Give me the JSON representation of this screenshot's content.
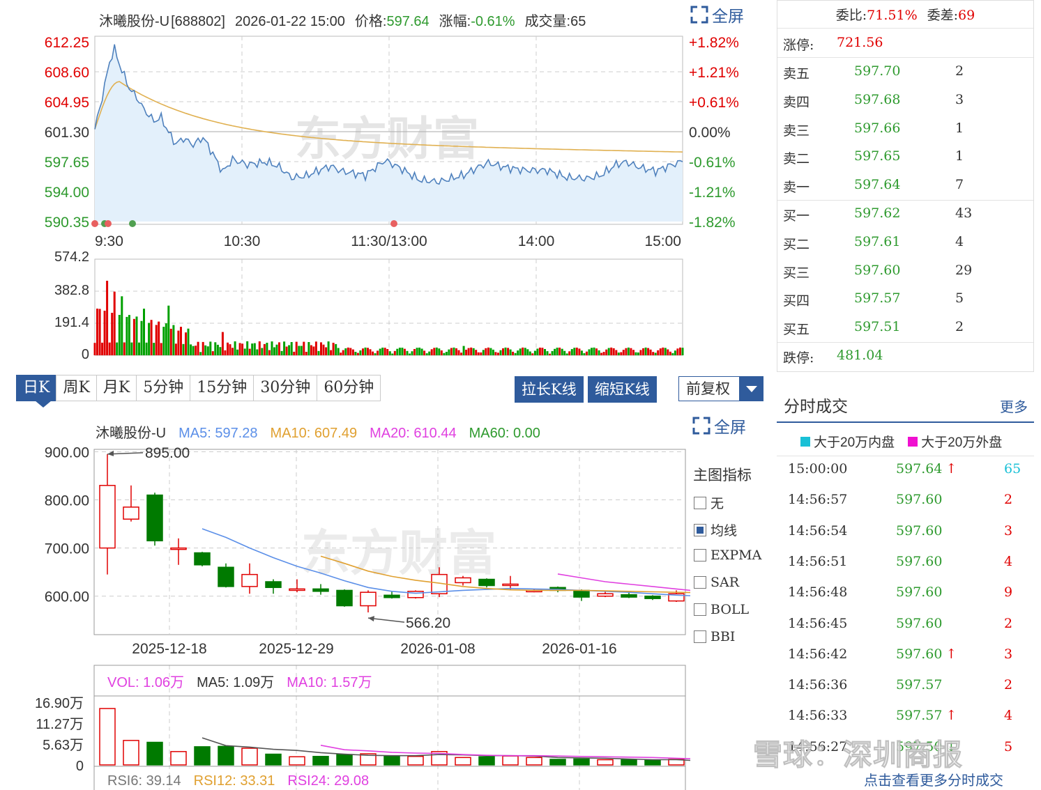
{
  "header": {
    "name": "沐曦股份-U",
    "code": "[688802]",
    "datetime": "2026-01-22 15:00",
    "price_label": "价格:",
    "price": "597.64",
    "change_label": "涨幅:",
    "change": "-0.61%",
    "volume_label": "成交量:",
    "volume": "65"
  },
  "fullscreen_label": "全屏",
  "watermark": "东方财富",
  "intraday_chart": {
    "price_ticks_left": [
      "612.25",
      "608.60",
      "604.95",
      "601.30",
      "597.65",
      "594.00",
      "590.35"
    ],
    "pct_ticks_right": [
      "+1.82%",
      "+1.21%",
      "+0.61%",
      "0.00%",
      "-0.61%",
      "-1.21%",
      "-1.82%"
    ],
    "time_ticks": [
      "9:30",
      "10:30",
      "11:30/13:00",
      "14:00",
      "15:00"
    ],
    "volume_ticks": [
      "574.2",
      "382.8",
      "191.4",
      "0"
    ],
    "pre_close": 601.3,
    "ylim": [
      590.35,
      612.25
    ],
    "volume_max": 574.2,
    "colors": {
      "price": "#4f81bd",
      "avg": "#e0b050",
      "up": "#e00000",
      "down": "#00a000",
      "fill": "#e3f0fb"
    }
  },
  "tabs": [
    "日K",
    "周K",
    "月K",
    "5分钟",
    "15分钟",
    "30分钟",
    "60分钟"
  ],
  "buttons": {
    "lengthen": "拉长K线",
    "shorten": "缩短K线",
    "adjust": "前复权"
  },
  "kline": {
    "legend": {
      "name": "沐曦股份-U",
      "ma5": "MA5: 597.28",
      "ma10": "MA10: 607.49",
      "ma20": "MA20: 610.44",
      "ma60": "MA60: 0.00"
    },
    "y_ticks": [
      "900.00",
      "800.00",
      "700.00",
      "600.00"
    ],
    "x_ticks": [
      "2025-12-18",
      "2025-12-29",
      "2026-01-08",
      "2026-01-16"
    ],
    "high_label": "895.00",
    "low_label": "566.20",
    "ylim": [
      520,
      905
    ],
    "candles": [
      {
        "o": 700,
        "c": 830,
        "h": 895,
        "l": 645
      },
      {
        "o": 760,
        "c": 785,
        "h": 830,
        "l": 755
      },
      {
        "o": 810,
        "c": 715,
        "h": 815,
        "l": 705
      },
      {
        "o": 700,
        "c": 700,
        "h": 720,
        "l": 665
      },
      {
        "o": 690,
        "c": 665,
        "h": 692,
        "l": 662
      },
      {
        "o": 660,
        "c": 620,
        "h": 668,
        "l": 618
      },
      {
        "o": 620,
        "c": 645,
        "h": 668,
        "l": 605
      },
      {
        "o": 630,
        "c": 618,
        "h": 635,
        "l": 605
      },
      {
        "o": 612,
        "c": 615,
        "h": 635,
        "l": 608
      },
      {
        "o": 615,
        "c": 610,
        "h": 625,
        "l": 603
      },
      {
        "o": 612,
        "c": 580,
        "h": 614,
        "l": 578
      },
      {
        "o": 580,
        "c": 608,
        "h": 612,
        "l": 566.2
      },
      {
        "o": 602,
        "c": 597,
        "h": 610,
        "l": 595
      },
      {
        "o": 597,
        "c": 610,
        "h": 612,
        "l": 595
      },
      {
        "o": 605,
        "c": 645,
        "h": 660,
        "l": 598
      },
      {
        "o": 628,
        "c": 638,
        "h": 642,
        "l": 622
      },
      {
        "o": 635,
        "c": 622,
        "h": 637,
        "l": 618
      },
      {
        "o": 625,
        "c": 625,
        "h": 642,
        "l": 612
      },
      {
        "o": 612,
        "c": 612,
        "h": 615,
        "l": 608
      },
      {
        "o": 618,
        "c": 612,
        "h": 620,
        "l": 608
      },
      {
        "o": 612,
        "c": 598,
        "h": 614,
        "l": 590
      },
      {
        "o": 600,
        "c": 605,
        "h": 610,
        "l": 598
      },
      {
        "o": 603,
        "c": 598,
        "h": 608,
        "l": 596
      },
      {
        "o": 600,
        "c": 595,
        "h": 602,
        "l": 592
      },
      {
        "o": 590,
        "c": 605,
        "h": 612,
        "l": 588
      },
      {
        "o": 600,
        "c": 598,
        "h": 605,
        "l": 596
      }
    ],
    "ma5": [
      null,
      null,
      null,
      null,
      740,
      722,
      700,
      680,
      662,
      648,
      632,
      618,
      610,
      606,
      609,
      612,
      614,
      616,
      615,
      614,
      612,
      610,
      608,
      605,
      602,
      600
    ],
    "ma10": [
      null,
      null,
      null,
      null,
      null,
      null,
      null,
      null,
      null,
      683,
      668,
      652,
      641,
      633,
      627,
      620,
      616,
      613,
      612,
      612,
      612,
      611,
      610,
      609,
      608,
      607
    ],
    "ma20": [
      null,
      null,
      null,
      null,
      null,
      null,
      null,
      null,
      null,
      null,
      null,
      null,
      null,
      null,
      null,
      null,
      null,
      null,
      null,
      646,
      638,
      630,
      625,
      620,
      615,
      610
    ],
    "colors": {
      "up": "#e00000",
      "down": "#007a00",
      "ma5": "#5b8fe8",
      "ma10": "#e0a030",
      "ma20": "#e040e0"
    }
  },
  "indicators": {
    "title": "主图指标",
    "items": [
      {
        "label": "无",
        "checked": false
      },
      {
        "label": "均线",
        "checked": true
      },
      {
        "label": "EXPMA",
        "checked": false
      },
      {
        "label": "SAR",
        "checked": false
      },
      {
        "label": "BOLL",
        "checked": false
      },
      {
        "label": "BBI",
        "checked": false
      }
    ]
  },
  "vol_panel": {
    "vol": "VOL: 1.06万",
    "ma5": "MA5: 1.09万",
    "ma10": "MA10: 1.57万",
    "y_ticks": [
      "16.90万",
      "11.27万",
      "5.63万",
      "0"
    ],
    "ylim": [
      0,
      16.9
    ],
    "values": [
      15.2,
      6.6,
      6.1,
      3.6,
      4.9,
      5.0,
      4.5,
      2.9,
      2.2,
      2.3,
      2.8,
      3.0,
      2.4,
      2.3,
      3.6,
      2.0,
      2.2,
      2.4,
      2.0,
      1.5,
      1.6,
      1.4,
      1.4,
      1.3,
      1.5,
      1.06
    ],
    "vol_ma5": [
      null,
      null,
      null,
      null,
      7.3,
      5.2,
      4.8,
      4.2,
      3.9,
      3.3,
      2.9,
      2.6,
      2.5,
      2.5,
      2.8,
      2.7,
      2.5,
      2.5,
      2.4,
      2.0,
      1.9,
      1.8,
      1.6,
      1.4,
      1.4,
      1.09
    ],
    "vol_ma10": [
      null,
      null,
      null,
      null,
      null,
      null,
      null,
      null,
      null,
      5.3,
      4.1,
      3.8,
      3.4,
      3.2,
      3.1,
      2.8,
      2.6,
      2.5,
      2.5,
      2.4,
      2.3,
      2.2,
      2.1,
      2.0,
      1.8,
      1.57
    ]
  },
  "rsi": {
    "rsi6": "RSI6: 39.14",
    "rsi12": "RSI12: 33.31",
    "rsi24": "RSI24: 29.08"
  },
  "orderbook": {
    "committee_ratio_label": "委比:",
    "committee_ratio": "71.51%",
    "committee_diff_label": "委差:",
    "committee_diff": "69",
    "limit_up_label": "涨停:",
    "limit_up": "721.56",
    "asks": [
      {
        "label": "卖五",
        "price": "597.70",
        "vol": "2"
      },
      {
        "label": "卖四",
        "price": "597.68",
        "vol": "3"
      },
      {
        "label": "卖三",
        "price": "597.66",
        "vol": "1"
      },
      {
        "label": "卖二",
        "price": "597.65",
        "vol": "1"
      },
      {
        "label": "卖一",
        "price": "597.64",
        "vol": "7"
      }
    ],
    "bids": [
      {
        "label": "买一",
        "price": "597.62",
        "vol": "43"
      },
      {
        "label": "买二",
        "price": "597.61",
        "vol": "4"
      },
      {
        "label": "买三",
        "price": "597.60",
        "vol": "29"
      },
      {
        "label": "买四",
        "price": "597.57",
        "vol": "5"
      },
      {
        "label": "买五",
        "price": "597.51",
        "vol": "2"
      }
    ],
    "limit_down_label": "跌停:",
    "limit_down": "481.04"
  },
  "trades": {
    "title": "分时成交",
    "more": "更多",
    "legend_inner": "大于20万内盘",
    "legend_outer": "大于20万外盘",
    "rows": [
      {
        "time": "15:00:00",
        "price": "597.64",
        "vol": "65",
        "dir": "up"
      },
      {
        "time": "14:56:57",
        "price": "597.60",
        "vol": "2",
        "dir": ""
      },
      {
        "time": "14:56:54",
        "price": "597.60",
        "vol": "3",
        "dir": ""
      },
      {
        "time": "14:56:51",
        "price": "597.60",
        "vol": "4",
        "dir": ""
      },
      {
        "time": "14:56:48",
        "price": "597.60",
        "vol": "9",
        "dir": ""
      },
      {
        "time": "14:56:45",
        "price": "597.60",
        "vol": "2",
        "dir": ""
      },
      {
        "time": "14:56:42",
        "price": "597.60",
        "vol": "3",
        "dir": "up"
      },
      {
        "time": "14:56:36",
        "price": "597.57",
        "vol": "2",
        "dir": ""
      },
      {
        "time": "14:56:33",
        "price": "597.57",
        "vol": "4",
        "dir": "up"
      },
      {
        "time": "14:56:27",
        "price": "597.50",
        "vol": "5",
        "dir": "down"
      }
    ],
    "view_more": "点击查看更多分时成交"
  },
  "overlay_watermark": "雪球：深圳商报"
}
